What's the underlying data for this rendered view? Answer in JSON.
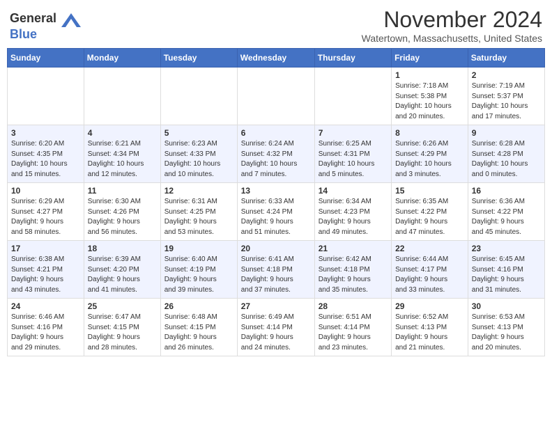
{
  "header": {
    "logo_general": "General",
    "logo_blue": "Blue",
    "title": "November 2024",
    "location": "Watertown, Massachusetts, United States"
  },
  "weekdays": [
    "Sunday",
    "Monday",
    "Tuesday",
    "Wednesday",
    "Thursday",
    "Friday",
    "Saturday"
  ],
  "weeks": [
    [
      {
        "day": "",
        "info": ""
      },
      {
        "day": "",
        "info": ""
      },
      {
        "day": "",
        "info": ""
      },
      {
        "day": "",
        "info": ""
      },
      {
        "day": "",
        "info": ""
      },
      {
        "day": "1",
        "info": "Sunrise: 7:18 AM\nSunset: 5:38 PM\nDaylight: 10 hours\nand 20 minutes."
      },
      {
        "day": "2",
        "info": "Sunrise: 7:19 AM\nSunset: 5:37 PM\nDaylight: 10 hours\nand 17 minutes."
      }
    ],
    [
      {
        "day": "3",
        "info": "Sunrise: 6:20 AM\nSunset: 4:35 PM\nDaylight: 10 hours\nand 15 minutes."
      },
      {
        "day": "4",
        "info": "Sunrise: 6:21 AM\nSunset: 4:34 PM\nDaylight: 10 hours\nand 12 minutes."
      },
      {
        "day": "5",
        "info": "Sunrise: 6:23 AM\nSunset: 4:33 PM\nDaylight: 10 hours\nand 10 minutes."
      },
      {
        "day": "6",
        "info": "Sunrise: 6:24 AM\nSunset: 4:32 PM\nDaylight: 10 hours\nand 7 minutes."
      },
      {
        "day": "7",
        "info": "Sunrise: 6:25 AM\nSunset: 4:31 PM\nDaylight: 10 hours\nand 5 minutes."
      },
      {
        "day": "8",
        "info": "Sunrise: 6:26 AM\nSunset: 4:29 PM\nDaylight: 10 hours\nand 3 minutes."
      },
      {
        "day": "9",
        "info": "Sunrise: 6:28 AM\nSunset: 4:28 PM\nDaylight: 10 hours\nand 0 minutes."
      }
    ],
    [
      {
        "day": "10",
        "info": "Sunrise: 6:29 AM\nSunset: 4:27 PM\nDaylight: 9 hours\nand 58 minutes."
      },
      {
        "day": "11",
        "info": "Sunrise: 6:30 AM\nSunset: 4:26 PM\nDaylight: 9 hours\nand 56 minutes."
      },
      {
        "day": "12",
        "info": "Sunrise: 6:31 AM\nSunset: 4:25 PM\nDaylight: 9 hours\nand 53 minutes."
      },
      {
        "day": "13",
        "info": "Sunrise: 6:33 AM\nSunset: 4:24 PM\nDaylight: 9 hours\nand 51 minutes."
      },
      {
        "day": "14",
        "info": "Sunrise: 6:34 AM\nSunset: 4:23 PM\nDaylight: 9 hours\nand 49 minutes."
      },
      {
        "day": "15",
        "info": "Sunrise: 6:35 AM\nSunset: 4:22 PM\nDaylight: 9 hours\nand 47 minutes."
      },
      {
        "day": "16",
        "info": "Sunrise: 6:36 AM\nSunset: 4:22 PM\nDaylight: 9 hours\nand 45 minutes."
      }
    ],
    [
      {
        "day": "17",
        "info": "Sunrise: 6:38 AM\nSunset: 4:21 PM\nDaylight: 9 hours\nand 43 minutes."
      },
      {
        "day": "18",
        "info": "Sunrise: 6:39 AM\nSunset: 4:20 PM\nDaylight: 9 hours\nand 41 minutes."
      },
      {
        "day": "19",
        "info": "Sunrise: 6:40 AM\nSunset: 4:19 PM\nDaylight: 9 hours\nand 39 minutes."
      },
      {
        "day": "20",
        "info": "Sunrise: 6:41 AM\nSunset: 4:18 PM\nDaylight: 9 hours\nand 37 minutes."
      },
      {
        "day": "21",
        "info": "Sunrise: 6:42 AM\nSunset: 4:18 PM\nDaylight: 9 hours\nand 35 minutes."
      },
      {
        "day": "22",
        "info": "Sunrise: 6:44 AM\nSunset: 4:17 PM\nDaylight: 9 hours\nand 33 minutes."
      },
      {
        "day": "23",
        "info": "Sunrise: 6:45 AM\nSunset: 4:16 PM\nDaylight: 9 hours\nand 31 minutes."
      }
    ],
    [
      {
        "day": "24",
        "info": "Sunrise: 6:46 AM\nSunset: 4:16 PM\nDaylight: 9 hours\nand 29 minutes."
      },
      {
        "day": "25",
        "info": "Sunrise: 6:47 AM\nSunset: 4:15 PM\nDaylight: 9 hours\nand 28 minutes."
      },
      {
        "day": "26",
        "info": "Sunrise: 6:48 AM\nSunset: 4:15 PM\nDaylight: 9 hours\nand 26 minutes."
      },
      {
        "day": "27",
        "info": "Sunrise: 6:49 AM\nSunset: 4:14 PM\nDaylight: 9 hours\nand 24 minutes."
      },
      {
        "day": "28",
        "info": "Sunrise: 6:51 AM\nSunset: 4:14 PM\nDaylight: 9 hours\nand 23 minutes."
      },
      {
        "day": "29",
        "info": "Sunrise: 6:52 AM\nSunset: 4:13 PM\nDaylight: 9 hours\nand 21 minutes."
      },
      {
        "day": "30",
        "info": "Sunrise: 6:53 AM\nSunset: 4:13 PM\nDaylight: 9 hours\nand 20 minutes."
      }
    ]
  ]
}
